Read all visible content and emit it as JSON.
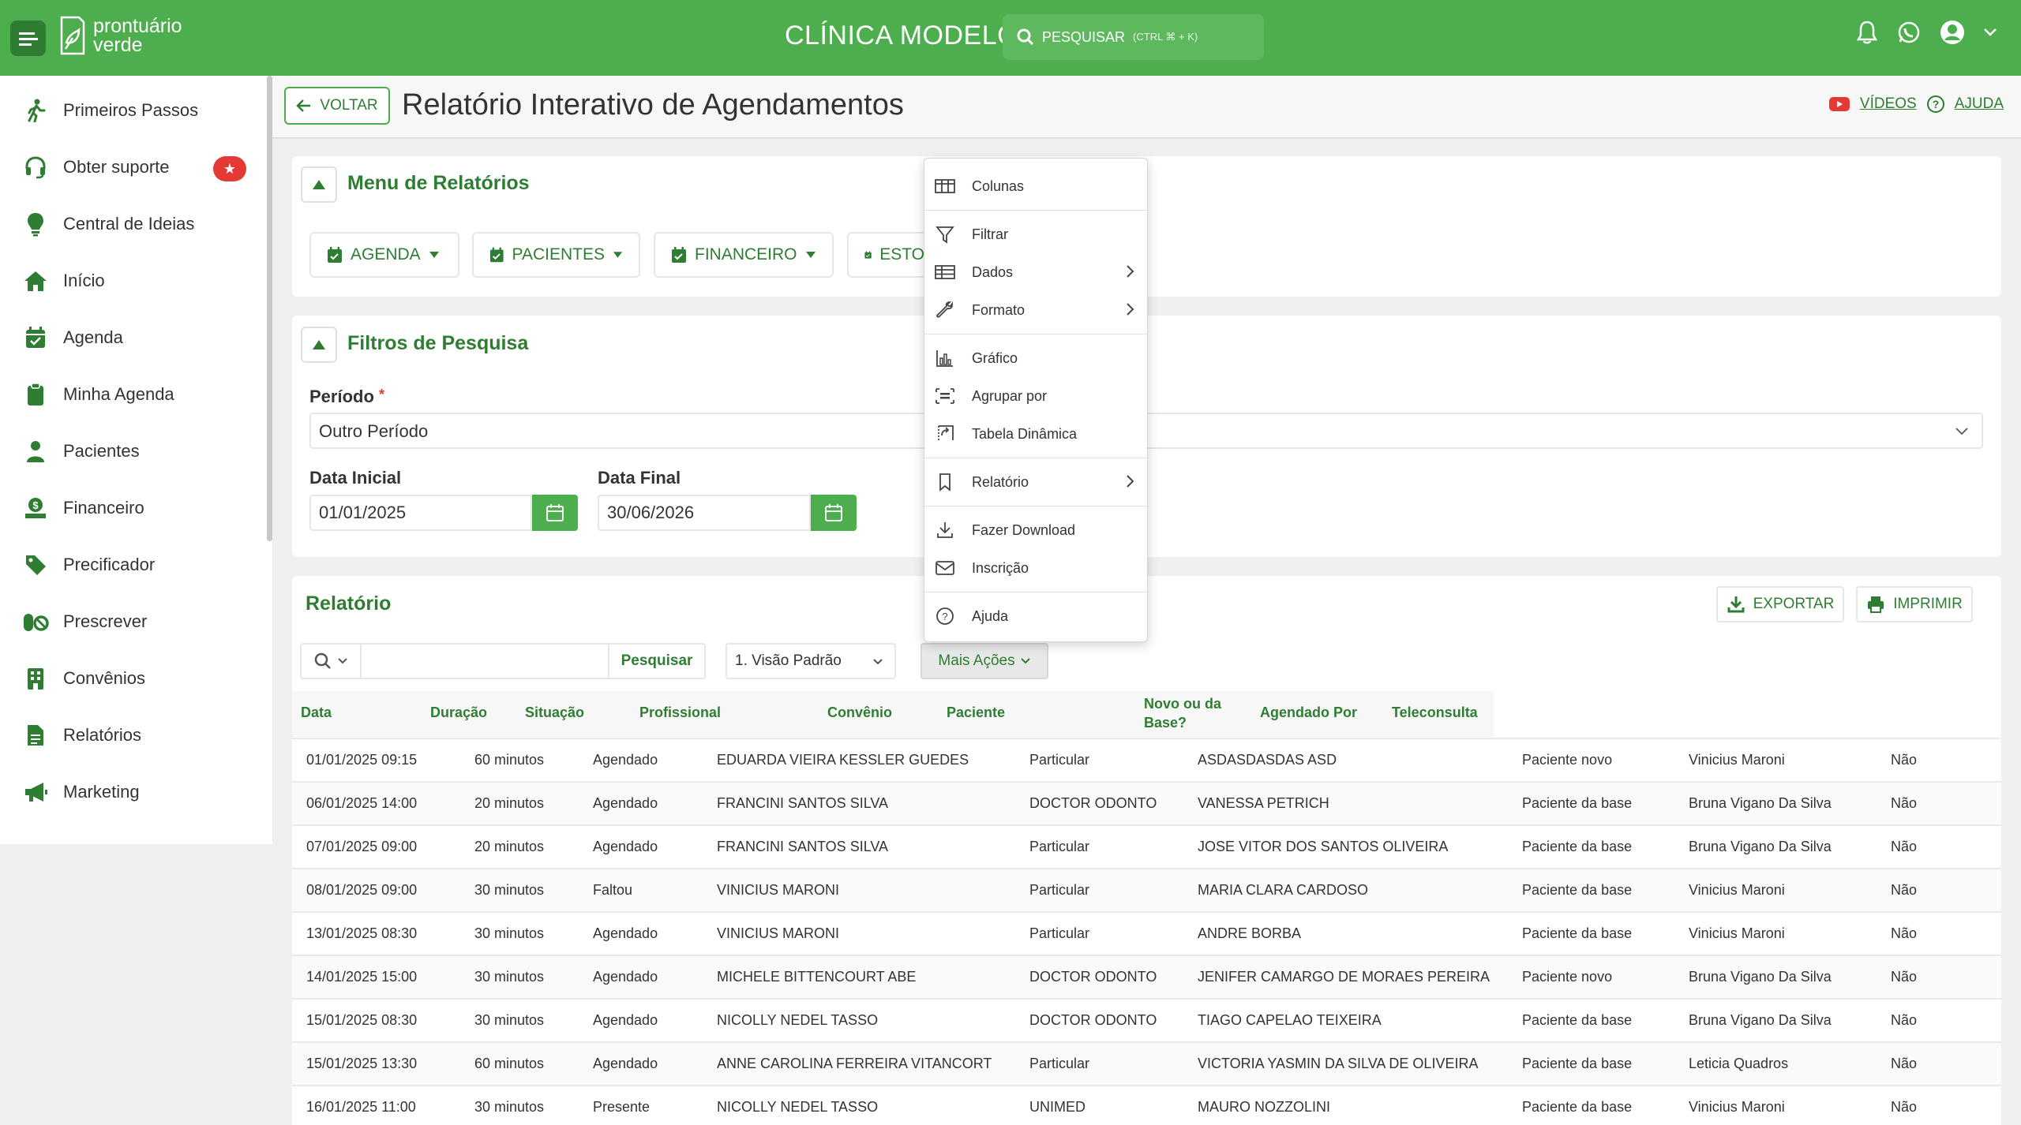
{
  "brand": {
    "logo_line1": "prontuário",
    "logo_line2": "verde",
    "clinic_name": "CLÍNICA MODELO"
  },
  "search": {
    "label": "PESQUISAR",
    "shortcut": "(CTRL ⌘ + K)"
  },
  "sidebar": {
    "items": [
      {
        "label": "Primeiros Passos",
        "icon": "walking-person-icon"
      },
      {
        "label": "Obter suporte",
        "icon": "headset-icon",
        "badge": "★"
      },
      {
        "label": "Central de Ideias",
        "icon": "lightbulb-icon"
      },
      {
        "label": "Início",
        "icon": "home-icon"
      },
      {
        "label": "Agenda",
        "icon": "calendar-icon"
      },
      {
        "label": "Minha Agenda",
        "icon": "clipboard-icon"
      },
      {
        "label": "Pacientes",
        "icon": "person-icon"
      },
      {
        "label": "Financeiro",
        "icon": "money-icon"
      },
      {
        "label": "Precificador",
        "icon": "tag-icon"
      },
      {
        "label": "Prescrever",
        "icon": "pills-icon"
      },
      {
        "label": "Convênios",
        "icon": "building-icon"
      },
      {
        "label": "Relatórios",
        "icon": "document-icon"
      },
      {
        "label": "Marketing",
        "icon": "megaphone-icon"
      }
    ]
  },
  "header": {
    "back_label": "VOLTAR",
    "title": "Relatório Interativo de Agendamentos",
    "videos_label": "VÍDEOS",
    "help_label": "AJUDA"
  },
  "reports_menu": {
    "title": "Menu de Relatórios",
    "buttons": [
      {
        "label": "AGENDA"
      },
      {
        "label": "PACIENTES"
      },
      {
        "label": "FINANCEIRO"
      },
      {
        "label": "ESTO"
      }
    ]
  },
  "filters": {
    "title": "Filtros de Pesquisa",
    "period_label": "Período",
    "period_required": "*",
    "period_value": "Outro Período",
    "start_label": "Data Inicial",
    "start_value": "01/01/2025",
    "end_label": "Data Final",
    "end_value": "30/06/2026"
  },
  "report": {
    "title": "Relatório",
    "export_label": "EXPORTAR",
    "print_label": "IMPRIMIR",
    "search_button": "Pesquisar",
    "view_select": "1. Visão Padrão",
    "actions_button": "Mais Ações",
    "columns": [
      "Data",
      "Duração",
      "Situação",
      "Profissional",
      "Convênio",
      "Paciente",
      "Novo ou da Base?",
      "Agendado Por",
      "Teleconsulta"
    ],
    "rows": [
      [
        "01/01/2025 09:15",
        "60 minutos",
        "Agendado",
        "EDUARDA VIEIRA KESSLER GUEDES",
        "Particular",
        "ASDASDASDAS ASD",
        "Paciente novo",
        "Vinicius Maroni",
        "Não"
      ],
      [
        "06/01/2025 14:00",
        "20 minutos",
        "Agendado",
        "FRANCINI SANTOS SILVA",
        "DOCTOR ODONTO",
        "VANESSA PETRICH",
        "Paciente da base",
        "Bruna Vigano Da Silva",
        "Não"
      ],
      [
        "07/01/2025 09:00",
        "20 minutos",
        "Agendado",
        "FRANCINI SANTOS SILVA",
        "Particular",
        "JOSE VITOR DOS SANTOS OLIVEIRA",
        "Paciente da base",
        "Bruna Vigano Da Silva",
        "Não"
      ],
      [
        "08/01/2025 09:00",
        "30 minutos",
        "Faltou",
        "VINICIUS MARONI",
        "Particular",
        "MARIA CLARA CARDOSO",
        "Paciente da base",
        "Vinicius Maroni",
        "Não"
      ],
      [
        "13/01/2025 08:30",
        "30 minutos",
        "Agendado",
        "VINICIUS MARONI",
        "Particular",
        "ANDRE BORBA",
        "Paciente da base",
        "Vinicius Maroni",
        "Não"
      ],
      [
        "14/01/2025 15:00",
        "30 minutos",
        "Agendado",
        "MICHELE BITTENCOURT ABE",
        "DOCTOR ODONTO",
        "JENIFER CAMARGO DE MORAES PEREIRA",
        "Paciente novo",
        "Bruna Vigano Da Silva",
        "Não"
      ],
      [
        "15/01/2025 08:30",
        "30 minutos",
        "Agendado",
        "NICOLLY NEDEL TASSO",
        "DOCTOR ODONTO",
        "TIAGO CAPELAO TEIXEIRA",
        "Paciente da base",
        "Bruna Vigano Da Silva",
        "Não"
      ],
      [
        "15/01/2025 13:30",
        "60 minutos",
        "Agendado",
        "ANNE CAROLINA FERREIRA VITANCORT",
        "Particular",
        "VICTORIA YASMIN DA SILVA DE OLIVEIRA",
        "Paciente da base",
        "Leticia Quadros",
        "Não"
      ],
      [
        "16/01/2025 11:00",
        "30 minutos",
        "Presente",
        "NICOLLY NEDEL TASSO",
        "UNIMED",
        "MAURO NOZZOLINI",
        "Paciente da base",
        "Vinicius Maroni",
        "Não"
      ]
    ]
  },
  "actions_menu": {
    "items": [
      {
        "label": "Colunas",
        "icon": "columns-icon"
      },
      {
        "label": "Filtrar",
        "icon": "filter-icon"
      },
      {
        "label": "Dados",
        "icon": "table-icon",
        "submenu": true
      },
      {
        "label": "Formato",
        "icon": "wrench-icon",
        "submenu": true
      },
      {
        "label": "Gráfico",
        "icon": "bar-chart-icon"
      },
      {
        "label": "Agrupar por",
        "icon": "group-icon"
      },
      {
        "label": "Tabela Dinâmica",
        "icon": "pivot-icon"
      },
      {
        "label": "Relatório",
        "icon": "bookmark-icon",
        "submenu": true
      },
      {
        "label": "Fazer Download",
        "icon": "download-icon"
      },
      {
        "label": "Inscrição",
        "icon": "mail-icon"
      },
      {
        "label": "Ajuda",
        "icon": "help-icon"
      }
    ]
  },
  "colors": {
    "brand_green": "#4cae4c",
    "dark_green": "#2f7d32",
    "badge_red": "#e53935"
  }
}
